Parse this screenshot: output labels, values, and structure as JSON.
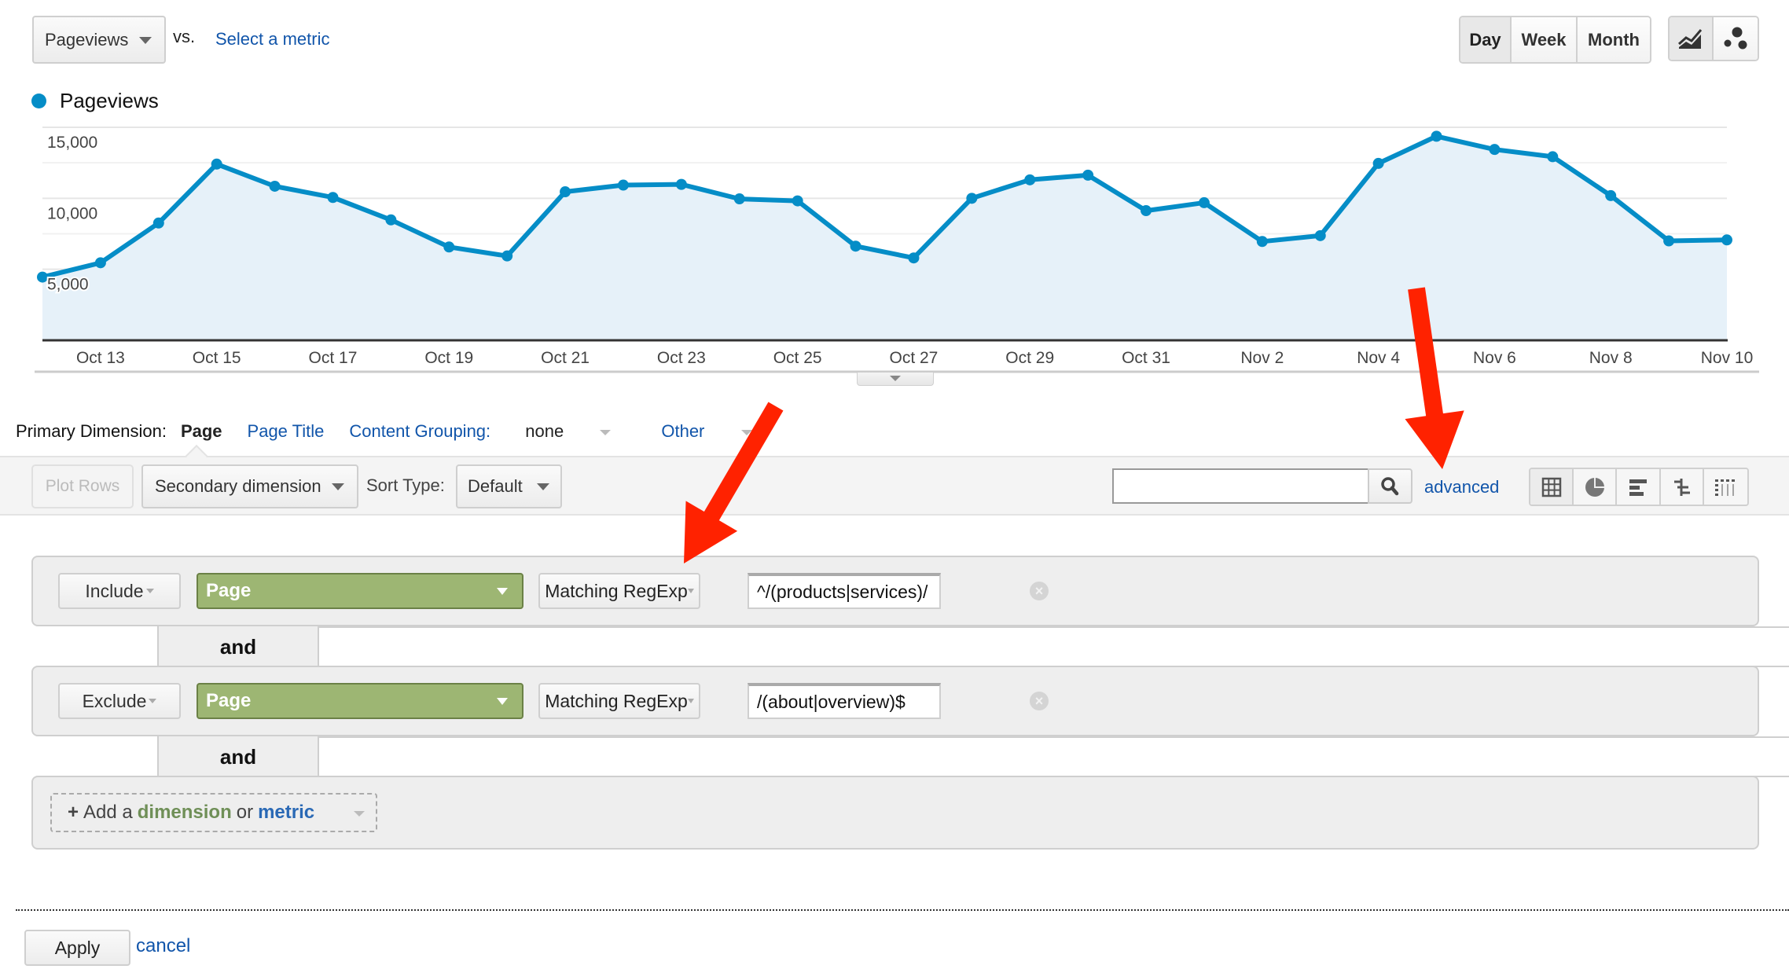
{
  "header": {
    "metric_select": "Pageviews",
    "vs_label": "vs.",
    "select_metric_link": "Select a metric",
    "period_buttons": [
      {
        "label": "Day",
        "active": true
      },
      {
        "label": "Week",
        "active": false
      },
      {
        "label": "Month",
        "active": false
      }
    ],
    "chart_type_buttons": [
      {
        "icon": "line-chart-icon",
        "active": true
      },
      {
        "icon": "motion-chart-icon",
        "active": false
      }
    ]
  },
  "legend": {
    "label": "Pageviews",
    "color": "#058dc7"
  },
  "chart_data": {
    "type": "line",
    "title": "",
    "xlabel": "",
    "ylabel": "",
    "series": [
      {
        "name": "Pageviews",
        "color": "#058dc7",
        "fill": "#e6f1f9",
        "values": [
          4450,
          5460,
          8260,
          12410,
          10850,
          10060,
          8480,
          6570,
          5940,
          10460,
          10930,
          10980,
          9960,
          9820,
          6630,
          5800,
          10000,
          11300,
          11630,
          9130,
          9690,
          6960,
          7370,
          12460,
          14370,
          13440,
          12930,
          10190,
          7000,
          7070
        ]
      }
    ],
    "x": [
      "Oct 12",
      "Oct 13",
      "Oct 14",
      "Oct 15",
      "Oct 16",
      "Oct 17",
      "Oct 18",
      "Oct 19",
      "Oct 20",
      "Oct 21",
      "Oct 22",
      "Oct 23",
      "Oct 24",
      "Oct 25",
      "Oct 26",
      "Oct 27",
      "Oct 28",
      "Oct 29",
      "Oct 30",
      "Oct 31",
      "Nov 1",
      "Nov 2",
      "Nov 3",
      "Nov 4",
      "Nov 5",
      "Nov 6",
      "Nov 7",
      "Nov 8",
      "Nov 9",
      "Nov 10"
    ],
    "x_tick_labels": [
      "Oct 13",
      "Oct 15",
      "Oct 17",
      "Oct 19",
      "Oct 21",
      "Oct 23",
      "Oct 25",
      "Oct 27",
      "Oct 29",
      "Oct 31",
      "Nov 2",
      "Nov 4",
      "Nov 6",
      "Nov 8",
      "Nov 10"
    ],
    "y_tick_labels": [
      "15,000",
      "10,000",
      "5,000"
    ],
    "y_ticks": [
      15000,
      10000,
      5000
    ],
    "ylim": [
      0,
      16667
    ],
    "grid": true,
    "legend_position": "top-left"
  },
  "primary_dimension": {
    "label": "Primary Dimension:",
    "selected": "Page",
    "options": [
      {
        "label": "Page Title",
        "dropdown": false
      },
      {
        "label": "Content Grouping:",
        "value": "none",
        "dropdown": true
      },
      {
        "label": "Other",
        "dropdown": true
      }
    ]
  },
  "toolbar": {
    "plot_rows": "Plot Rows",
    "secondary_dimension": "Secondary dimension",
    "sort_type_label": "Sort Type:",
    "sort_type_value": "Default",
    "search_value": "",
    "advanced_link": "advanced",
    "view_buttons": [
      {
        "icon": "data-table-icon",
        "active": true
      },
      {
        "icon": "pie-chart-icon",
        "active": false
      },
      {
        "icon": "performance-bar-icon",
        "active": false
      },
      {
        "icon": "comparison-icon",
        "active": false
      },
      {
        "icon": "pivot-table-icon",
        "active": false
      }
    ]
  },
  "filters": {
    "rows": [
      {
        "type": "Include",
        "dimension": "Page",
        "match": "Matching RegExp",
        "value": "^/(products|services)/"
      },
      {
        "type": "Exclude",
        "dimension": "Page",
        "match": "Matching RegExp",
        "value": "/(about|overview)$"
      }
    ],
    "and_label": "and",
    "add": {
      "prefix": "+",
      "text1": "Add a",
      "dimension": "dimension",
      "or": "or",
      "metric": "metric"
    }
  },
  "actions": {
    "apply": "Apply",
    "cancel": "cancel"
  },
  "annotations": {
    "arrow_color": "#ff2200"
  }
}
